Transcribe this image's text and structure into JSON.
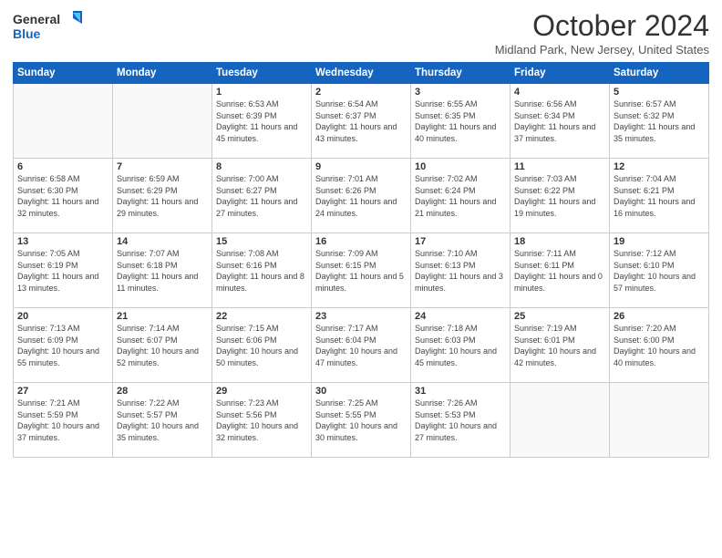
{
  "header": {
    "logo_general": "General",
    "logo_blue": "Blue",
    "month": "October 2024",
    "location": "Midland Park, New Jersey, United States"
  },
  "days_of_week": [
    "Sunday",
    "Monday",
    "Tuesday",
    "Wednesday",
    "Thursday",
    "Friday",
    "Saturday"
  ],
  "weeks": [
    [
      {
        "day": "",
        "sunrise": "",
        "sunset": "",
        "daylight": ""
      },
      {
        "day": "",
        "sunrise": "",
        "sunset": "",
        "daylight": ""
      },
      {
        "day": "1",
        "sunrise": "Sunrise: 6:53 AM",
        "sunset": "Sunset: 6:39 PM",
        "daylight": "Daylight: 11 hours and 45 minutes."
      },
      {
        "day": "2",
        "sunrise": "Sunrise: 6:54 AM",
        "sunset": "Sunset: 6:37 PM",
        "daylight": "Daylight: 11 hours and 43 minutes."
      },
      {
        "day": "3",
        "sunrise": "Sunrise: 6:55 AM",
        "sunset": "Sunset: 6:35 PM",
        "daylight": "Daylight: 11 hours and 40 minutes."
      },
      {
        "day": "4",
        "sunrise": "Sunrise: 6:56 AM",
        "sunset": "Sunset: 6:34 PM",
        "daylight": "Daylight: 11 hours and 37 minutes."
      },
      {
        "day": "5",
        "sunrise": "Sunrise: 6:57 AM",
        "sunset": "Sunset: 6:32 PM",
        "daylight": "Daylight: 11 hours and 35 minutes."
      }
    ],
    [
      {
        "day": "6",
        "sunrise": "Sunrise: 6:58 AM",
        "sunset": "Sunset: 6:30 PM",
        "daylight": "Daylight: 11 hours and 32 minutes."
      },
      {
        "day": "7",
        "sunrise": "Sunrise: 6:59 AM",
        "sunset": "Sunset: 6:29 PM",
        "daylight": "Daylight: 11 hours and 29 minutes."
      },
      {
        "day": "8",
        "sunrise": "Sunrise: 7:00 AM",
        "sunset": "Sunset: 6:27 PM",
        "daylight": "Daylight: 11 hours and 27 minutes."
      },
      {
        "day": "9",
        "sunrise": "Sunrise: 7:01 AM",
        "sunset": "Sunset: 6:26 PM",
        "daylight": "Daylight: 11 hours and 24 minutes."
      },
      {
        "day": "10",
        "sunrise": "Sunrise: 7:02 AM",
        "sunset": "Sunset: 6:24 PM",
        "daylight": "Daylight: 11 hours and 21 minutes."
      },
      {
        "day": "11",
        "sunrise": "Sunrise: 7:03 AM",
        "sunset": "Sunset: 6:22 PM",
        "daylight": "Daylight: 11 hours and 19 minutes."
      },
      {
        "day": "12",
        "sunrise": "Sunrise: 7:04 AM",
        "sunset": "Sunset: 6:21 PM",
        "daylight": "Daylight: 11 hours and 16 minutes."
      }
    ],
    [
      {
        "day": "13",
        "sunrise": "Sunrise: 7:05 AM",
        "sunset": "Sunset: 6:19 PM",
        "daylight": "Daylight: 11 hours and 13 minutes."
      },
      {
        "day": "14",
        "sunrise": "Sunrise: 7:07 AM",
        "sunset": "Sunset: 6:18 PM",
        "daylight": "Daylight: 11 hours and 11 minutes."
      },
      {
        "day": "15",
        "sunrise": "Sunrise: 7:08 AM",
        "sunset": "Sunset: 6:16 PM",
        "daylight": "Daylight: 11 hours and 8 minutes."
      },
      {
        "day": "16",
        "sunrise": "Sunrise: 7:09 AM",
        "sunset": "Sunset: 6:15 PM",
        "daylight": "Daylight: 11 hours and 5 minutes."
      },
      {
        "day": "17",
        "sunrise": "Sunrise: 7:10 AM",
        "sunset": "Sunset: 6:13 PM",
        "daylight": "Daylight: 11 hours and 3 minutes."
      },
      {
        "day": "18",
        "sunrise": "Sunrise: 7:11 AM",
        "sunset": "Sunset: 6:11 PM",
        "daylight": "Daylight: 11 hours and 0 minutes."
      },
      {
        "day": "19",
        "sunrise": "Sunrise: 7:12 AM",
        "sunset": "Sunset: 6:10 PM",
        "daylight": "Daylight: 10 hours and 57 minutes."
      }
    ],
    [
      {
        "day": "20",
        "sunrise": "Sunrise: 7:13 AM",
        "sunset": "Sunset: 6:09 PM",
        "daylight": "Daylight: 10 hours and 55 minutes."
      },
      {
        "day": "21",
        "sunrise": "Sunrise: 7:14 AM",
        "sunset": "Sunset: 6:07 PM",
        "daylight": "Daylight: 10 hours and 52 minutes."
      },
      {
        "day": "22",
        "sunrise": "Sunrise: 7:15 AM",
        "sunset": "Sunset: 6:06 PM",
        "daylight": "Daylight: 10 hours and 50 minutes."
      },
      {
        "day": "23",
        "sunrise": "Sunrise: 7:17 AM",
        "sunset": "Sunset: 6:04 PM",
        "daylight": "Daylight: 10 hours and 47 minutes."
      },
      {
        "day": "24",
        "sunrise": "Sunrise: 7:18 AM",
        "sunset": "Sunset: 6:03 PM",
        "daylight": "Daylight: 10 hours and 45 minutes."
      },
      {
        "day": "25",
        "sunrise": "Sunrise: 7:19 AM",
        "sunset": "Sunset: 6:01 PM",
        "daylight": "Daylight: 10 hours and 42 minutes."
      },
      {
        "day": "26",
        "sunrise": "Sunrise: 7:20 AM",
        "sunset": "Sunset: 6:00 PM",
        "daylight": "Daylight: 10 hours and 40 minutes."
      }
    ],
    [
      {
        "day": "27",
        "sunrise": "Sunrise: 7:21 AM",
        "sunset": "Sunset: 5:59 PM",
        "daylight": "Daylight: 10 hours and 37 minutes."
      },
      {
        "day": "28",
        "sunrise": "Sunrise: 7:22 AM",
        "sunset": "Sunset: 5:57 PM",
        "daylight": "Daylight: 10 hours and 35 minutes."
      },
      {
        "day": "29",
        "sunrise": "Sunrise: 7:23 AM",
        "sunset": "Sunset: 5:56 PM",
        "daylight": "Daylight: 10 hours and 32 minutes."
      },
      {
        "day": "30",
        "sunrise": "Sunrise: 7:25 AM",
        "sunset": "Sunset: 5:55 PM",
        "daylight": "Daylight: 10 hours and 30 minutes."
      },
      {
        "day": "31",
        "sunrise": "Sunrise: 7:26 AM",
        "sunset": "Sunset: 5:53 PM",
        "daylight": "Daylight: 10 hours and 27 minutes."
      },
      {
        "day": "",
        "sunrise": "",
        "sunset": "",
        "daylight": ""
      },
      {
        "day": "",
        "sunrise": "",
        "sunset": "",
        "daylight": ""
      }
    ]
  ]
}
